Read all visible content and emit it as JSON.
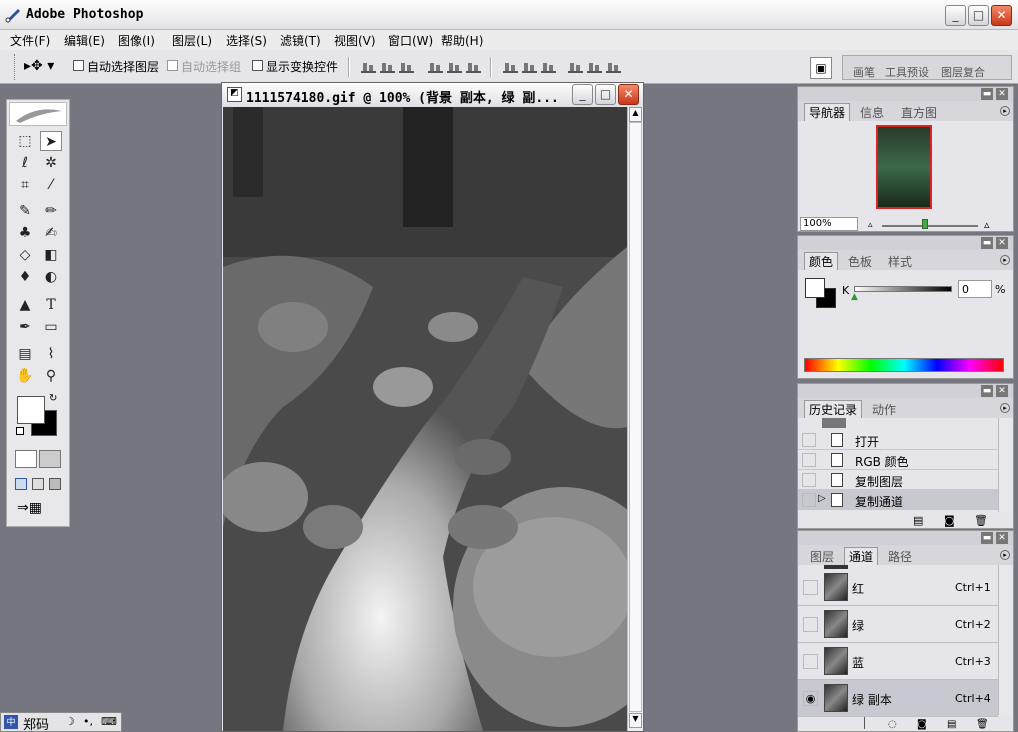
{
  "app": {
    "title": "Adobe Photoshop"
  },
  "window_controls": {
    "minimize": "_",
    "maximize": "□",
    "close": "✕"
  },
  "menu": [
    "文件(F)",
    "编辑(E)",
    "图像(I)",
    "图层(L)",
    "选择(S)",
    "滤镜(T)",
    "视图(V)",
    "窗口(W)",
    "帮助(H)"
  ],
  "options": {
    "auto_select_layer": "自动选择图层",
    "auto_select_group": "自动选择组",
    "show_transform": "显示变换控件",
    "well_tabs": [
      "画笔",
      "工具预设",
      "图层复合"
    ]
  },
  "document": {
    "title": "1111574180.gif @ 100% (背景 副本, 绿 副..."
  },
  "navigator": {
    "tabs": [
      "导航器",
      "信息",
      "直方图"
    ],
    "zoom": "100%"
  },
  "color": {
    "tabs": [
      "颜色",
      "色板",
      "样式"
    ],
    "channel_label": "K",
    "value": "0",
    "unit": "%"
  },
  "history": {
    "tabs": [
      "历史记录",
      "动作"
    ],
    "items": [
      "打开",
      "RGB 颜色",
      "复制图层",
      "复制通道"
    ],
    "active_index": 3
  },
  "channels": {
    "tabs": [
      "图层",
      "通道",
      "路径"
    ],
    "rows": [
      {
        "name": "红",
        "shortcut": "Ctrl+1"
      },
      {
        "name": "绿",
        "shortcut": "Ctrl+2"
      },
      {
        "name": "蓝",
        "shortcut": "Ctrl+3"
      },
      {
        "name": "绿 副本",
        "shortcut": "Ctrl+4"
      }
    ]
  },
  "ime": {
    "label": "郑码"
  },
  "colors": {
    "accent_red": "#c9381a",
    "panel_bg": "#e6e6ea",
    "workspace": "#767680"
  }
}
